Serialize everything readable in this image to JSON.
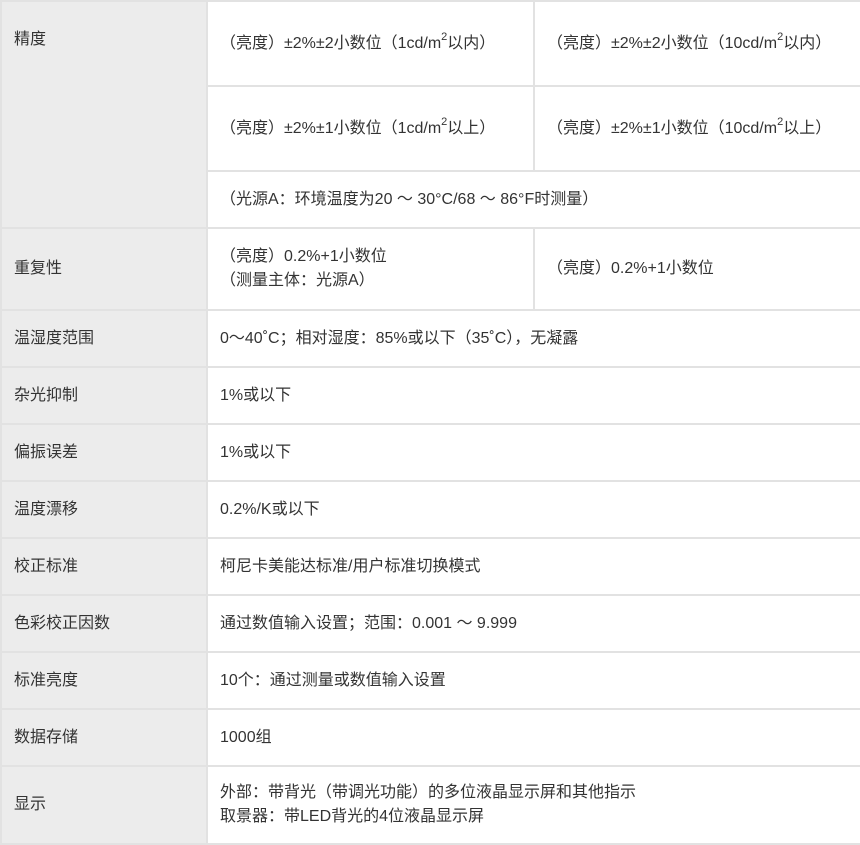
{
  "rows": {
    "precision": {
      "label": "精度",
      "r1": {
        "a": "（亮度）±2%±2小数位（1cd/m",
        "a_tail": "以内）",
        "b": "（亮度）±2%±2小数位（10cd/m",
        "b_tail": "以内）"
      },
      "r2": {
        "a": "（亮度）±2%±1小数位（1cd/m",
        "a_tail": "以上）",
        "b": "（亮度）±2%±1小数位（10cd/m",
        "b_tail": "以上）"
      },
      "sup": "2",
      "note": "（光源A：环境温度为20 ～ 30°C/68 ～ 86°F时测量）"
    },
    "repeatability": {
      "label": "重复性",
      "a1": "（亮度）0.2%+1小数位",
      "a2": "（测量主体：光源A）",
      "b": "（亮度）0.2%+1小数位"
    },
    "temp_humidity": {
      "label": "温湿度范围",
      "value": "0～40˚C；相对湿度：85%或以下（35˚C），无凝露"
    },
    "stray_light": {
      "label": "杂光抑制",
      "value": "1%或以下"
    },
    "polarization": {
      "label": "偏振误差",
      "value": "1%或以下"
    },
    "temp_drift": {
      "label": "温度漂移",
      "value": "0.2%/K或以下"
    },
    "calibration": {
      "label": "校正标准",
      "value": "柯尼卡美能达标准/用户标准切换模式"
    },
    "color_factor": {
      "label": "色彩校正因数",
      "value": "通过数值输入设置；范围：0.001 ～ 9.999"
    },
    "std_luminance": {
      "label": "标准亮度",
      "value": "10个：通过测量或数值输入设置"
    },
    "data_storage": {
      "label": "数据存储",
      "value": "1000组"
    },
    "display": {
      "label": "显示",
      "line1": "外部：带背光（带调光功能）的多位液晶显示屏和其他指示",
      "line2": "取景器：带LED背光的4位液晶显示屏"
    }
  }
}
